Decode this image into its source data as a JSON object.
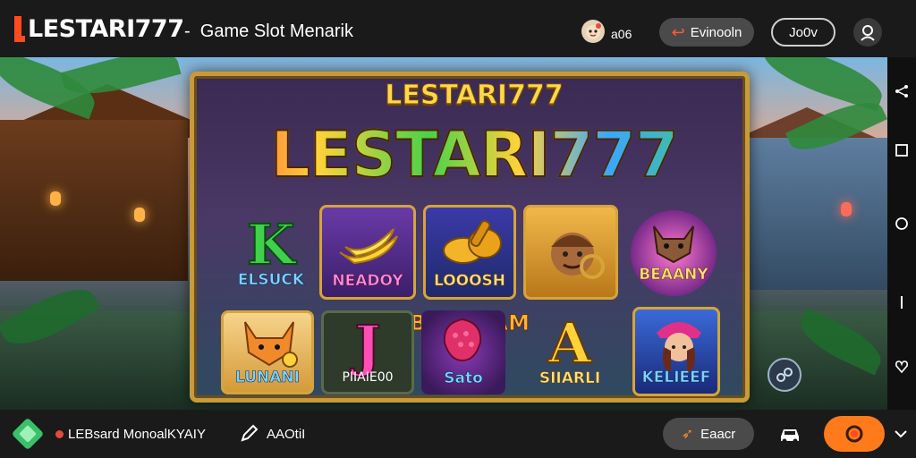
{
  "header": {
    "logo_text": "LESTARI777",
    "separator": "-",
    "subtitle": "Game Slot Menarik",
    "coin_count": "a06",
    "exit_label": "Evinooln",
    "outline_label": "Jo0v"
  },
  "panel": {
    "small_title": "LESTARI777",
    "big_title": "LESTARI777",
    "banner": "BERAGAM FITUR",
    "top_tiles": [
      {
        "symbol": "K",
        "label": "ELSUCK"
      },
      {
        "label": "NEADOY"
      },
      {
        "label": "LOOOSH"
      },
      {
        "label": ""
      },
      {
        "label": "BEAANY"
      }
    ],
    "bottom_tiles": [
      {
        "label": "LUNANI"
      },
      {
        "symbol": "J",
        "label": "PIIAIE00"
      },
      {
        "label": "Sato"
      },
      {
        "symbol": "A",
        "label": "SIIARLI"
      },
      {
        "label": "KELIEEF"
      }
    ]
  },
  "footer": {
    "user_name": "LEBsard MonoalKYAIY",
    "edit_label": "AAOtiI",
    "enter_label": "Eaacr"
  },
  "colors": {
    "accent_orange": "#ff7a1a",
    "gold_frame": "#c89a3a",
    "exit_arrow": "#ff5a3c"
  },
  "icons": [
    "logo-mark-icon",
    "mascot-chip-icon",
    "exit-arrow-icon",
    "avatar-icon",
    "share-icon",
    "square-icon",
    "circle-icon",
    "bar-icon",
    "heart-icon",
    "gem-icon",
    "pencil-icon",
    "rocket-icon",
    "car-icon",
    "chevron-down-icon",
    "link-icon"
  ]
}
